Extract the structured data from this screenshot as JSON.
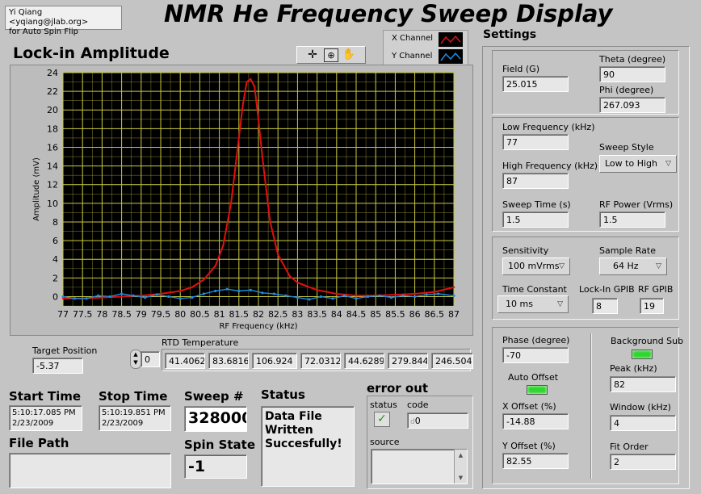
{
  "author": {
    "line1": "Yi Qiang <yqiang@jlab.org>",
    "line2": "for Auto Spin Flip"
  },
  "title": "NMR He Frequency Sweep Display",
  "graph": {
    "title": "Lock-in Amplitude",
    "legend": [
      {
        "name": "X Channel",
        "color": "#e01010"
      },
      {
        "name": "Y Channel",
        "color": "#1e8ce0"
      }
    ],
    "tools": [
      "crosshair-icon",
      "zoom-icon",
      "pan-hand-icon"
    ]
  },
  "chart_data": {
    "type": "line",
    "xlabel": "RF Frequency (kHz)",
    "ylabel": "Amplitude (mV)",
    "xlim": [
      77,
      87
    ],
    "ylim": [
      -1,
      24
    ],
    "x_ticks": [
      "77",
      "77.5",
      "78",
      "78.5",
      "79",
      "79.5",
      "80",
      "80.5",
      "81",
      "81.5",
      "82",
      "82.5",
      "83",
      "83.5",
      "84",
      "84.5",
      "85",
      "85.5",
      "86",
      "86.5",
      "87"
    ],
    "y_ticks": [
      "0",
      "2",
      "4",
      "6",
      "8",
      "10",
      "12",
      "14",
      "16",
      "18",
      "20",
      "22",
      "24"
    ],
    "grid": true,
    "background": "#000000",
    "grid_color": "#c8c840",
    "series": [
      {
        "name": "X Channel",
        "color": "#e01010",
        "x": [
          77,
          77.5,
          78,
          78.5,
          79,
          79.5,
          80,
          80.3,
          80.6,
          80.9,
          81.1,
          81.3,
          81.5,
          81.6,
          81.7,
          81.8,
          81.9,
          82.0,
          82.1,
          82.3,
          82.5,
          82.8,
          83,
          83.5,
          84,
          84.5,
          85,
          85.5,
          86,
          86.5,
          87
        ],
        "y": [
          -0.2,
          -0.2,
          -0.1,
          0,
          0.1,
          0.3,
          0.6,
          1.0,
          1.8,
          3.3,
          5.5,
          10,
          17,
          20.5,
          23,
          23.3,
          22.5,
          19,
          15,
          8,
          4.5,
          2.2,
          1.5,
          0.7,
          0.3,
          0.1,
          0.1,
          0.2,
          0.3,
          0.5,
          1.0
        ]
      },
      {
        "name": "Y Channel",
        "color": "#1e8ce0",
        "x": [
          77,
          77.3,
          77.6,
          77.9,
          78.2,
          78.5,
          78.8,
          79.1,
          79.4,
          79.7,
          80,
          80.3,
          80.6,
          80.9,
          81.2,
          81.5,
          81.8,
          82.1,
          82.4,
          82.7,
          83,
          83.3,
          83.6,
          83.9,
          84.2,
          84.5,
          84.8,
          85.1,
          85.4,
          85.7,
          86,
          86.3,
          86.6,
          87
        ],
        "y": [
          0,
          -0.2,
          -0.2,
          0.1,
          0,
          0.3,
          0.1,
          -0.1,
          0.2,
          0,
          -0.2,
          -0.1,
          0.3,
          0.6,
          0.8,
          0.6,
          0.7,
          0.4,
          0.3,
          0.1,
          -0.1,
          -0.3,
          0,
          -0.2,
          0.1,
          -0.2,
          0,
          0.1,
          -0.1,
          0.1,
          0,
          0.2,
          0.3,
          0.1
        ]
      }
    ]
  },
  "target_position": {
    "label": "Target Position",
    "value": "-5.37"
  },
  "rtd": {
    "label": "RTD Temperature",
    "index": "0",
    "values": [
      "41.4062",
      "83.6816",
      "106.924",
      "72.0312",
      "44.6289",
      "279.844",
      "246.504"
    ]
  },
  "start_time": {
    "label": "Start Time",
    "time": "5:10:17.085 PM",
    "date": "2/23/2009"
  },
  "stop_time": {
    "label": "Stop Time",
    "time": "5:10:19.851 PM",
    "date": "2/23/2009"
  },
  "sweep": {
    "label": "Sweep #",
    "value": "328000"
  },
  "spin_state": {
    "label": "Spin State",
    "value": "-1"
  },
  "status": {
    "label": "Status",
    "text": "Data File Written Succesfully!"
  },
  "file_path": {
    "label": "File Path",
    "value": ""
  },
  "error_out": {
    "label": "error out",
    "status_label": "status",
    "code_label": "code",
    "code_value": "0",
    "code_prefix": "d",
    "source_label": "source"
  },
  "settings": {
    "label": "Settings",
    "field": {
      "label": "Field (G)",
      "value": "25.015"
    },
    "theta": {
      "label": "Theta (degree)",
      "value": "90"
    },
    "phi": {
      "label": "Phi (degree)",
      "value": "267.093"
    },
    "low_freq": {
      "label": "Low Frequency (kHz)",
      "value": "77"
    },
    "high_freq": {
      "label": "High Frequency (kHz)",
      "value": "87"
    },
    "sweep_style": {
      "label": "Sweep Style",
      "value": "Low to High"
    },
    "sweep_time": {
      "label": "Sweep Time (s)",
      "value": "1.5"
    },
    "rf_power": {
      "label": "RF Power (Vrms)",
      "value": "1.5"
    },
    "sensitivity": {
      "label": "Sensitivity",
      "value": "100 mVrms"
    },
    "sample_rate": {
      "label": "Sample Rate",
      "value": "64 Hz"
    },
    "time_constant": {
      "label": "Time Constant",
      "value": "10 ms"
    },
    "lockin_gpib": {
      "label": "Lock-In GPIB",
      "value": "8"
    },
    "rf_gpib": {
      "label": "RF GPIB",
      "value": "19"
    },
    "phase": {
      "label": "Phase (degree)",
      "value": "-70"
    },
    "background_sub": {
      "label": "Background Sub"
    },
    "auto_offset": {
      "label": "Auto Offset"
    },
    "peak": {
      "label": "Peak (kHz)",
      "value": "82"
    },
    "x_offset": {
      "label": "X Offset (%)",
      "value": "-14.88"
    },
    "window": {
      "label": "Window (kHz)",
      "value": "4"
    },
    "y_offset": {
      "label": "Y Offset (%)",
      "value": "82.55"
    },
    "fit_order": {
      "label": "Fit Order",
      "value": "2"
    }
  }
}
